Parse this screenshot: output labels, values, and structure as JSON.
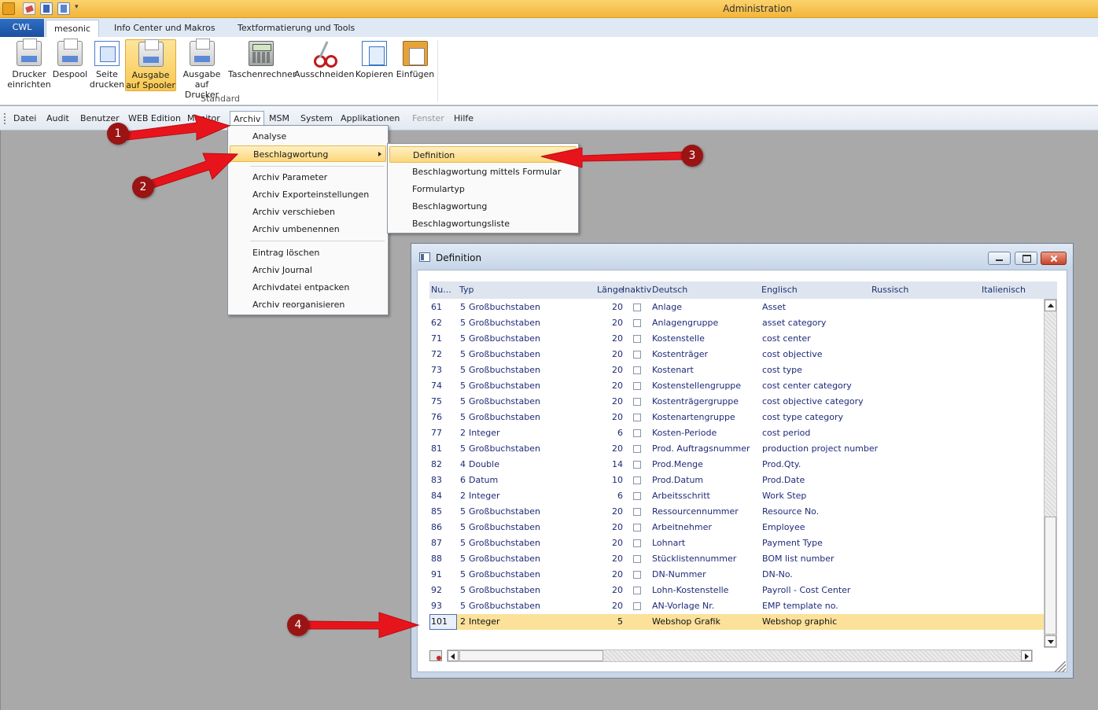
{
  "window": {
    "title": "Administration"
  },
  "ribbon": {
    "tabs": [
      {
        "label": "CWL"
      },
      {
        "label": "mesonic"
      },
      {
        "label": "Info Center und Makros"
      },
      {
        "label": "Textformatierung und Tools"
      }
    ],
    "active_tab": "mesonic",
    "group_label": "Standard",
    "buttons": [
      {
        "label_1": "Drucker",
        "label_2": "einrichten",
        "icon": "printer-setup-icon"
      },
      {
        "label_1": "Despool",
        "label_2": "",
        "icon": "despool-icon"
      },
      {
        "label_1": "Seite",
        "label_2": "drucken",
        "icon": "print-page-icon"
      },
      {
        "label_1": "Ausgabe",
        "label_2": "auf Spooler",
        "icon": "spooler-icon"
      },
      {
        "label_1": "Ausgabe",
        "label_2": "auf Drucker",
        "icon": "output-printer-icon"
      },
      {
        "label_1": "Taschenrechner",
        "label_2": "",
        "icon": "calculator-icon"
      },
      {
        "label_1": "Ausschneiden",
        "label_2": "",
        "icon": "scissors-icon"
      },
      {
        "label_1": "Kopieren",
        "label_2": "",
        "icon": "copy-icon"
      },
      {
        "label_1": "Einfügen",
        "label_2": "",
        "icon": "paste-icon"
      }
    ]
  },
  "menubar": {
    "items": [
      {
        "label": "Datei"
      },
      {
        "label": "Audit"
      },
      {
        "label": "Benutzer"
      },
      {
        "label": "WEB Edition"
      },
      {
        "label": "Monitor"
      },
      {
        "label": "Archiv"
      },
      {
        "label": "MSM"
      },
      {
        "label": "System"
      },
      {
        "label": "Applikationen"
      },
      {
        "label": "Fenster"
      },
      {
        "label": "Hilfe"
      }
    ],
    "active": "Archiv",
    "disabled": [
      "Fenster"
    ]
  },
  "archiv_menu": {
    "items": [
      {
        "label": "Analyse"
      },
      {
        "label": "Beschlagwortung"
      },
      {
        "label": "Archiv Parameter"
      },
      {
        "label": "Archiv Exporteinstellungen"
      },
      {
        "label": "Archiv verschieben"
      },
      {
        "label": "Archiv umbenennen"
      },
      {
        "label": "Eintrag löschen"
      },
      {
        "label": "Archiv Journal"
      },
      {
        "label": "Archivdatei entpacken"
      },
      {
        "label": "Archiv reorganisieren"
      }
    ]
  },
  "beschlagwortung_submenu": {
    "items": [
      {
        "label": "Definition"
      },
      {
        "label": "Beschlagwortung mittels Formular"
      },
      {
        "label": "Formulartyp"
      },
      {
        "label": "Beschlagwortung"
      },
      {
        "label": "Beschlagwortungsliste"
      }
    ]
  },
  "definition_window": {
    "title": "Definition",
    "columns": {
      "nr": "Nu...",
      "typ": "Typ",
      "laenge": "Länge",
      "inaktiv": "Inaktiv",
      "deutsch": "Deutsch",
      "englisch": "Englisch",
      "russisch": "Russisch",
      "italienisch": "Italienisch"
    },
    "rows": [
      {
        "nr": "61",
        "typ_code": "5",
        "typ": "Großbuchstaben",
        "laenge": "20",
        "deutsch": "Anlage",
        "englisch": "Asset"
      },
      {
        "nr": "62",
        "typ_code": "5",
        "typ": "Großbuchstaben",
        "laenge": "20",
        "deutsch": "Anlagengruppe",
        "englisch": "asset category"
      },
      {
        "nr": "71",
        "typ_code": "5",
        "typ": "Großbuchstaben",
        "laenge": "20",
        "deutsch": "Kostenstelle",
        "englisch": "cost center"
      },
      {
        "nr": "72",
        "typ_code": "5",
        "typ": "Großbuchstaben",
        "laenge": "20",
        "deutsch": "Kostenträger",
        "englisch": "cost objective"
      },
      {
        "nr": "73",
        "typ_code": "5",
        "typ": "Großbuchstaben",
        "laenge": "20",
        "deutsch": "Kostenart",
        "englisch": "cost type"
      },
      {
        "nr": "74",
        "typ_code": "5",
        "typ": "Großbuchstaben",
        "laenge": "20",
        "deutsch": "Kostenstellengruppe",
        "englisch": "cost center category"
      },
      {
        "nr": "75",
        "typ_code": "5",
        "typ": "Großbuchstaben",
        "laenge": "20",
        "deutsch": "Kostenträgergruppe",
        "englisch": "cost objective category"
      },
      {
        "nr": "76",
        "typ_code": "5",
        "typ": "Großbuchstaben",
        "laenge": "20",
        "deutsch": "Kostenartengruppe",
        "englisch": "cost type category"
      },
      {
        "nr": "77",
        "typ_code": "2",
        "typ": "Integer",
        "laenge": "6",
        "deutsch": "Kosten-Periode",
        "englisch": "cost period"
      },
      {
        "nr": "81",
        "typ_code": "5",
        "typ": "Großbuchstaben",
        "laenge": "20",
        "deutsch": "Prod. Auftragsnummer",
        "englisch": "production project number"
      },
      {
        "nr": "82",
        "typ_code": "4",
        "typ": "Double",
        "laenge": "14",
        "deutsch": "Prod.Menge",
        "englisch": "Prod.Qty."
      },
      {
        "nr": "83",
        "typ_code": "6",
        "typ": "Datum",
        "laenge": "10",
        "deutsch": "Prod.Datum",
        "englisch": "Prod.Date"
      },
      {
        "nr": "84",
        "typ_code": "2",
        "typ": "Integer",
        "laenge": "6",
        "deutsch": "Arbeitsschritt",
        "englisch": "Work Step"
      },
      {
        "nr": "85",
        "typ_code": "5",
        "typ": "Großbuchstaben",
        "laenge": "20",
        "deutsch": "Ressourcennummer",
        "englisch": "Resource No."
      },
      {
        "nr": "86",
        "typ_code": "5",
        "typ": "Großbuchstaben",
        "laenge": "20",
        "deutsch": "Arbeitnehmer",
        "englisch": "Employee"
      },
      {
        "nr": "87",
        "typ_code": "5",
        "typ": "Großbuchstaben",
        "laenge": "20",
        "deutsch": "Lohnart",
        "englisch": "Payment Type"
      },
      {
        "nr": "88",
        "typ_code": "5",
        "typ": "Großbuchstaben",
        "laenge": "20",
        "deutsch": "Stücklistennummer",
        "englisch": "BOM list number"
      },
      {
        "nr": "91",
        "typ_code": "5",
        "typ": "Großbuchstaben",
        "laenge": "20",
        "deutsch": "DN-Nummer",
        "englisch": "DN-No."
      },
      {
        "nr": "92",
        "typ_code": "5",
        "typ": "Großbuchstaben",
        "laenge": "20",
        "deutsch": "Lohn-Kostenstelle",
        "englisch": "Payroll - Cost Center"
      },
      {
        "nr": "93",
        "typ_code": "5",
        "typ": "Großbuchstaben",
        "laenge": "20",
        "deutsch": "AN-Vorlage Nr.",
        "englisch": "EMP template no."
      },
      {
        "nr": "101",
        "typ_code": "2",
        "typ": "Integer",
        "laenge": "5",
        "deutsch": "Webshop Grafik",
        "englisch": "Webshop graphic",
        "selected": true
      }
    ]
  },
  "annotations": [
    {
      "label": "1"
    },
    {
      "label": "2"
    },
    {
      "label": "3"
    },
    {
      "label": "4"
    }
  ],
  "colors": {
    "titlebar": "#f3b53a",
    "cwl_tab": "#1c4f9e",
    "menu_highlight": "#fcd77b",
    "selected_row": "#fbe19a",
    "grid_text": "#1f2a78",
    "annotation": "#9a1414",
    "arrow": "#e8141c"
  }
}
